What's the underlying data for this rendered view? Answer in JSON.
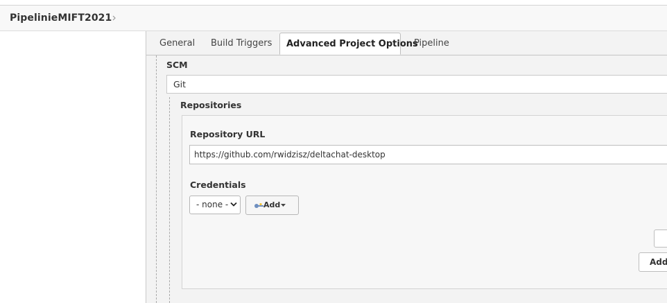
{
  "breadcrumb": {
    "job_name": "PipelinieMIFT2021"
  },
  "tabs": [
    {
      "label": "General",
      "active": false
    },
    {
      "label": "Build Triggers",
      "active": false
    },
    {
      "label": "Advanced Project Options",
      "active": true
    },
    {
      "label": "Pipeline",
      "active": false
    }
  ],
  "scm": {
    "label": "SCM",
    "selected": "Git"
  },
  "repositories": {
    "label": "Repositories",
    "repository_url_label": "Repository URL",
    "repository_url_value": "https://github.com/rwidzisz/deltachat-desktop",
    "credentials_label": "Credentials",
    "credentials_selected": "- none -",
    "add_button_label": "Add",
    "add_repository_label": "Add"
  },
  "colors": {
    "tab_bar_bg": "#f3f3f3",
    "active_tab_bg": "#ffffff",
    "border": "#c9c9c9",
    "text": "#333333"
  },
  "icons": [
    "chevron-right-icon",
    "chevron-down-icon",
    "key-icon",
    "caret-down-icon"
  ]
}
